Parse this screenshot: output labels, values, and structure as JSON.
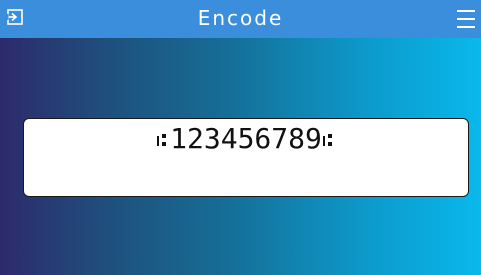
{
  "header": {
    "title": "Encode",
    "back_icon": "exit-icon",
    "menu_icon": "hamburger-menu-icon"
  },
  "display": {
    "value": "123456789",
    "start_marker_icon": "start-bar-marker-icon",
    "end_marker_icon": "end-bar-marker-icon"
  },
  "colors": {
    "header_bg": "#3b8edc",
    "gradient_left": "#2d2a6b",
    "gradient_right": "#09b8ec",
    "panel_bg": "#ffffff",
    "text": "#111111"
  }
}
